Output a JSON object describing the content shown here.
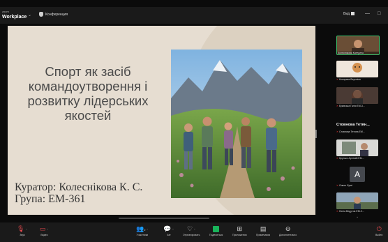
{
  "app": {
    "logo_small": "zoom",
    "logo_big": "Workplace",
    "conference_label": "Конференция",
    "view_label": "Вид",
    "window_controls": [
      "—",
      "□"
    ]
  },
  "slide": {
    "title": "Спорт як засіб командоутворення і розвитку лідерських якостей",
    "curator": "Куратор: Колеснікова К. С.",
    "group": "Група: ЕМ-361",
    "photo_icon": "hikers-mountain-image"
  },
  "participants": [
    {
      "name": "Колесникова Катерина",
      "muted": false,
      "kind": "video",
      "bg": "#7a5a3a"
    },
    {
      "name": "Косиревa Вероніка",
      "muted": true,
      "kind": "video",
      "bg": "#c28a50"
    },
    {
      "name": "Буківська Галія ЕМ-3...",
      "muted": true,
      "kind": "video",
      "bg": "#8a6a5a"
    },
    {
      "name": "Стовнова Тетян...",
      "muted": false,
      "kind": "name"
    },
    {
      "name": "Стовнова Тетяна ЕМ...",
      "muted": true,
      "kind": "label"
    },
    {
      "name": "Крутько Артемій ЕМ...",
      "muted": true,
      "kind": "video",
      "bg": "#6f7c6a"
    },
    {
      "name": "Сивон Єрмі",
      "muted": true,
      "kind": "avatar",
      "initial": "A"
    },
    {
      "name": "Нікіта Ведутов ЕМ-3...",
      "muted": true,
      "kind": "video",
      "bg": "#5a6a7a"
    }
  ],
  "toolbar": {
    "audio": "Звук",
    "video": "Видео",
    "participants": "Участники",
    "participants_count": "2",
    "chat": "Чат",
    "react": "Отреагировать",
    "share": "Поделиться",
    "apps": "Приложения",
    "notes": "Примечания",
    "more": "Дополнительно",
    "leave": "Выйти"
  },
  "colors": {
    "muted": "#e5484d",
    "share": "#19b35a",
    "slide_bg": "#e6ddd1"
  }
}
